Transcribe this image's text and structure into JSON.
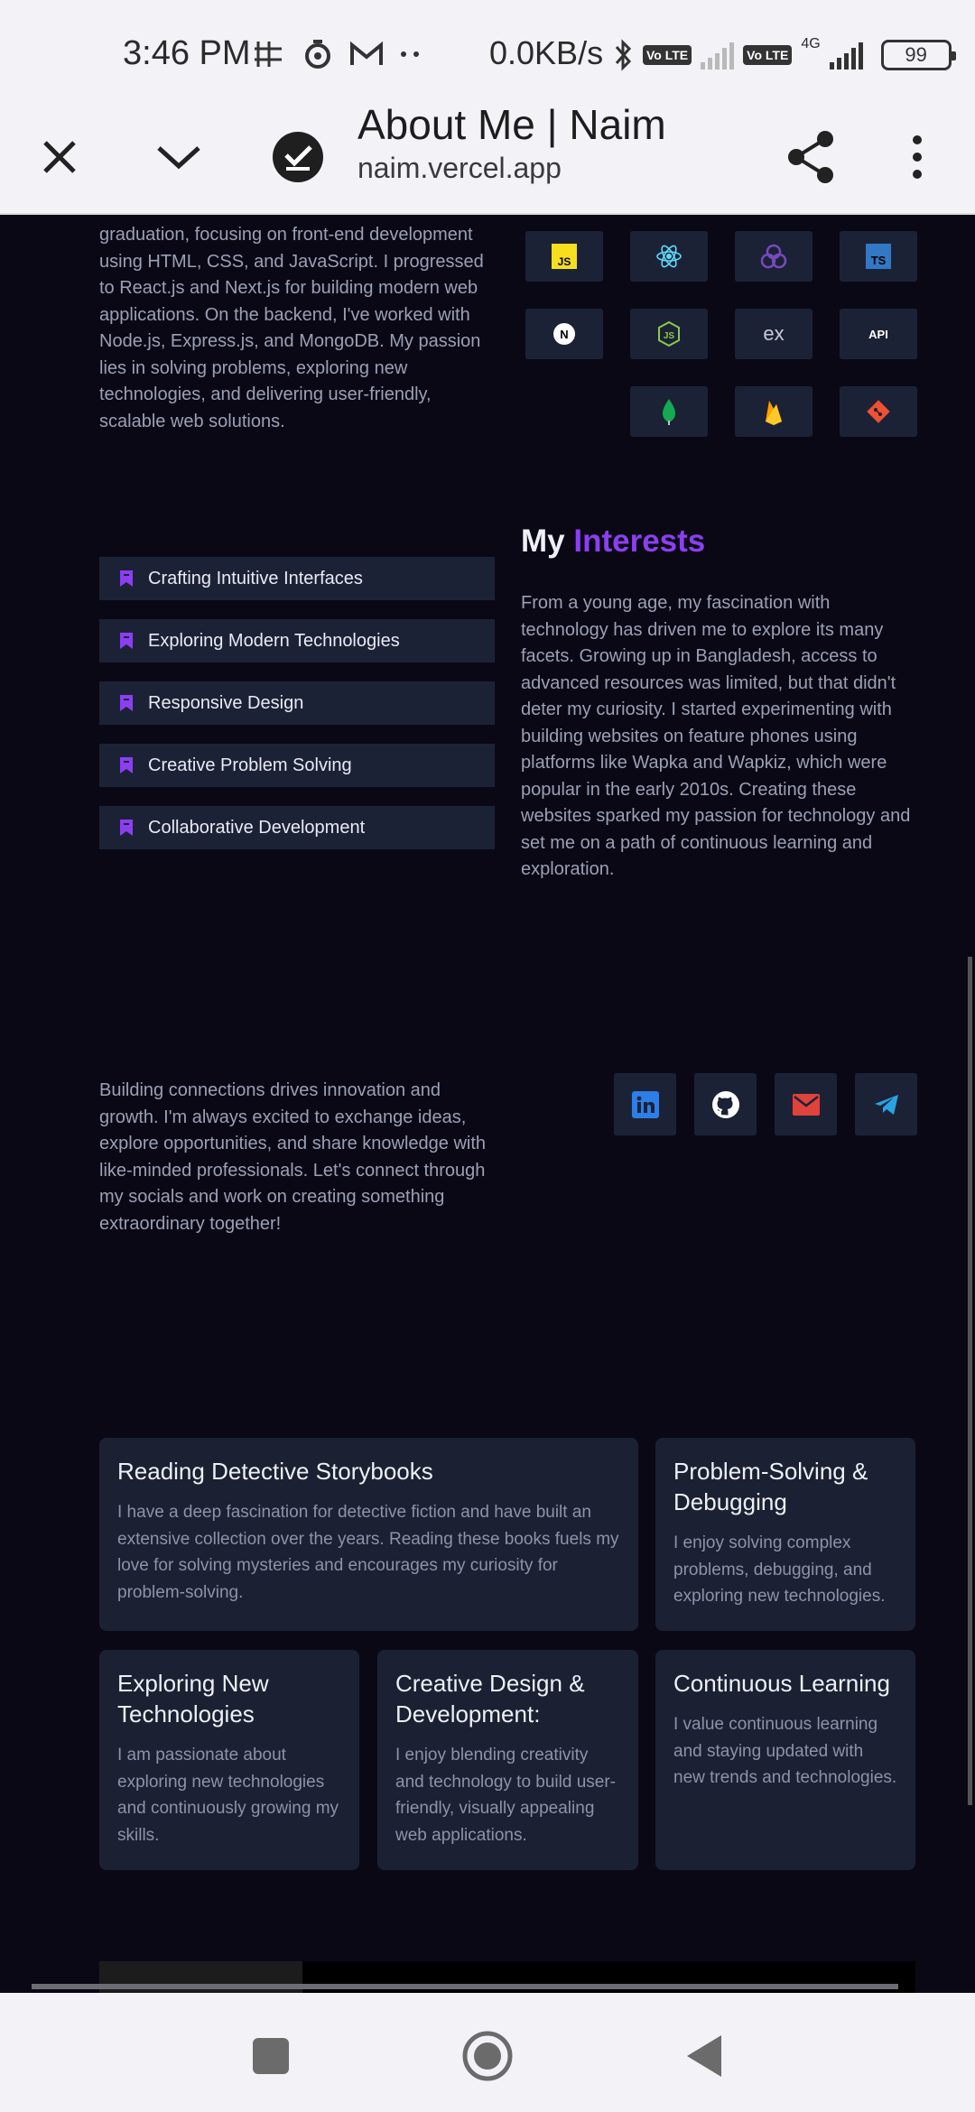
{
  "status_bar": {
    "time": "3:46 PM",
    "net_speed": "0.0KB/s",
    "lte1": "Vo LTE",
    "lte2": "Vo LTE",
    "net_type": "4G",
    "battery": "99"
  },
  "browser": {
    "title": "About Me | Naim",
    "url": "naim.vercel.app"
  },
  "about": {
    "intro_text": "graduation, focusing on front-end development using HTML, CSS, and JavaScript. I progressed to React.js and Next.js for building modern web applications. On the backend, I've worked with Node.js, Express.js, and MongoDB. My passion lies in solving problems, exploring new technologies, and delivering user-friendly, scalable web solutions."
  },
  "skills": [
    {
      "name": "javascript-icon",
      "label": "JS",
      "color": "#f7df1e"
    },
    {
      "name": "react-icon",
      "label": "",
      "color": "#61dafb"
    },
    {
      "name": "redux-icon",
      "label": "",
      "color": "#764abc"
    },
    {
      "name": "typescript-icon",
      "label": "TS",
      "color": "#3178c6"
    },
    {
      "name": "nextjs-icon",
      "label": "N",
      "color": "#ffffff"
    },
    {
      "name": "nodejs-icon",
      "label": "JS",
      "color": "#8cc84b"
    },
    {
      "name": "express-icon",
      "label": "ex",
      "color": "#c9ccd6"
    },
    {
      "name": "api-icon",
      "label": "API",
      "color": "#ffffff"
    },
    {
      "name": "mongodb-icon",
      "label": "",
      "color": "#13aa52"
    },
    {
      "name": "firebase-icon",
      "label": "",
      "color": "#ffca28"
    },
    {
      "name": "git-icon",
      "label": "",
      "color": "#f05033"
    }
  ],
  "interests": {
    "title_plain": "My",
    "title_accent": "Interests",
    "items": [
      "Crafting Intuitive Interfaces",
      "Exploring Modern Technologies",
      "Responsive Design",
      "Creative Problem Solving",
      "Collaborative Development"
    ],
    "text": "From a young age, my fascination with technology has driven me to explore its many facets. Growing up in Bangladesh, access to advanced resources was limited, but that didn't deter my curiosity. I started experimenting with building websites on feature phones using platforms like Wapka and Wapkiz, which were popular in the early 2010s. Creating these websites sparked my passion for technology and set me on a path of continuous learning and exploration."
  },
  "connect": {
    "text": "Building connections drives innovation and growth. I'm always excited to exchange ideas, explore opportunities, and share knowledge with like-minded professionals. Let's connect through my socials and work on creating something extraordinary together!",
    "socials": [
      {
        "name": "linkedin-icon",
        "color": "#2d7ee6"
      },
      {
        "name": "github-icon",
        "color": "#ffffff"
      },
      {
        "name": "email-icon",
        "color": "#e0433b"
      },
      {
        "name": "telegram-icon",
        "color": "#2aa3e5"
      }
    ]
  },
  "hobbies": [
    {
      "title": "Reading Detective Storybooks",
      "text": "I have a deep fascination for detective fiction and have built an extensive collection over the years. Reading these books fuels my love for solving mysteries and encourages my curiosity for problem-solving."
    },
    {
      "title": "Problem-Solving & Debugging",
      "text": "I enjoy solving complex problems, debugging, and exploring new technologies."
    },
    {
      "title": "Exploring New Technologies",
      "text": "I am passionate about exploring new technologies and continuously growing my skills."
    },
    {
      "title": "Creative Design & Development:",
      "text": "I enjoy blending creativity and technology to build user-friendly, visually appealing web applications."
    },
    {
      "title": "Continuous Learning",
      "text": "I value continuous learning and staying updated with new trends and technologies."
    }
  ]
}
